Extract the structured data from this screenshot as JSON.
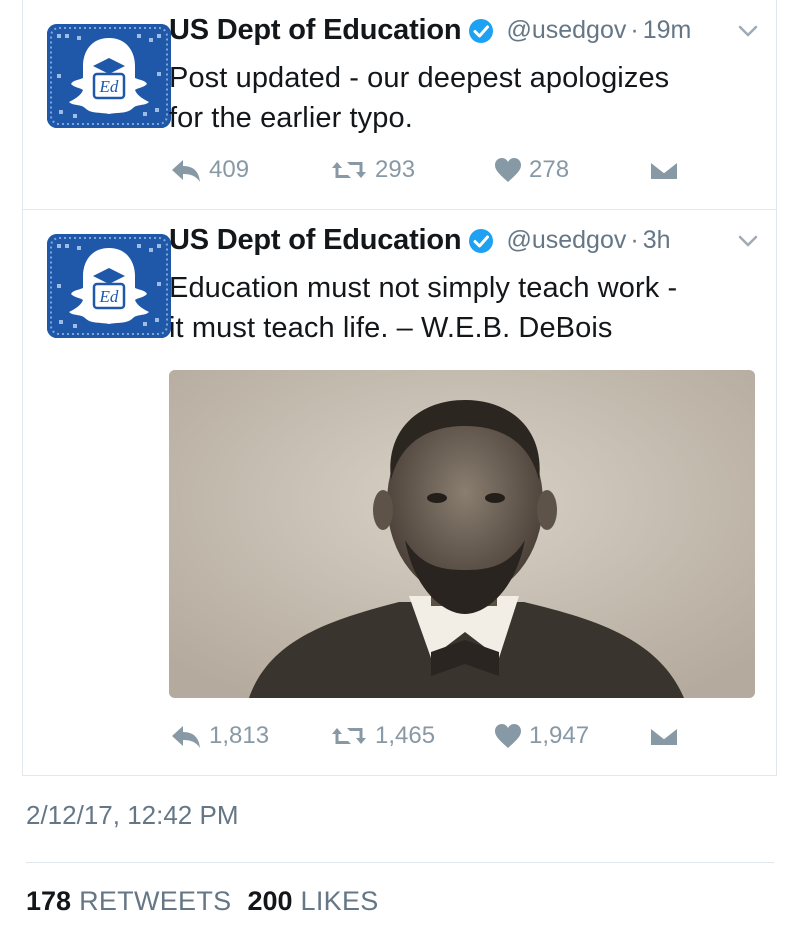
{
  "tweets": [
    {
      "author": "US Dept of Education",
      "handle": "@usedgov",
      "separator": "·",
      "time": "19m",
      "text_lines": [
        "Post updated - our deepest apologizes",
        "for the earlier typo."
      ],
      "replies": "409",
      "retweets": "293",
      "likes": "278"
    },
    {
      "author": "US Dept of Education",
      "handle": "@usedgov",
      "separator": "·",
      "time": "3h",
      "text_lines": [
        "Education must not simply teach work -",
        "it must teach life. – W.E.B. DeBois"
      ],
      "replies": "1,813",
      "retweets": "1,465",
      "likes": "1,947"
    }
  ],
  "footer": {
    "timestamp": "2/12/17, 12:42 PM",
    "retweet_count": "178",
    "retweet_label": "RETWEETS",
    "like_count": "200",
    "like_label": "LIKES"
  },
  "icons": {
    "verified": "verified-badge-icon",
    "menu": "chevron-down-icon",
    "reply": "reply-icon",
    "retweet": "retweet-icon",
    "like": "heart-icon",
    "message": "envelope-icon",
    "avatar_logo": "ed-snapchat-ghost-icon"
  },
  "colors": {
    "avatar_blue": "#1f58a8",
    "verified_blue": "#1da1f2",
    "icon_gray": "#8899a6",
    "secondary_text": "#657786"
  }
}
